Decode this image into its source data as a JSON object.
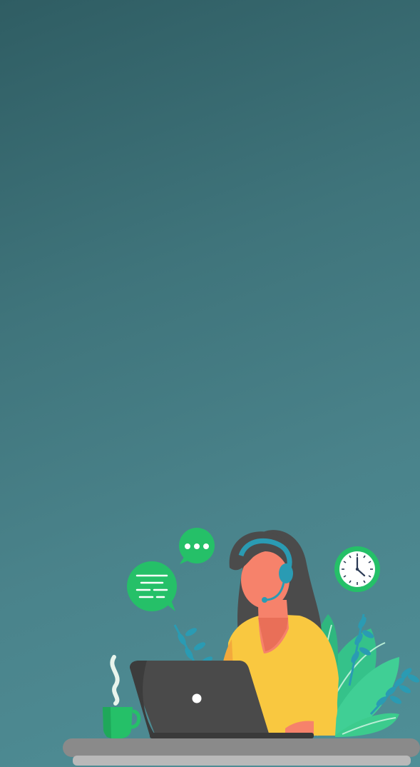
{
  "screen": {
    "background_colors": [
      "#2f5d63",
      "#4f8f97"
    ],
    "illustration": {
      "subject": "customer-support-agent",
      "icons": [
        "speech-bubble-icon",
        "chat-typing-icon",
        "clock-icon",
        "laptop-icon",
        "coffee-cup-icon",
        "plant-icon",
        "headset-icon"
      ],
      "clock_time": "5:00",
      "accent_green": "#25c068",
      "accent_blue": "#2a9bb3",
      "shirt_yellow": "#f9c840",
      "laptop_gray": "#4a4a4a",
      "desk_gray": "#8a8a8a"
    }
  }
}
